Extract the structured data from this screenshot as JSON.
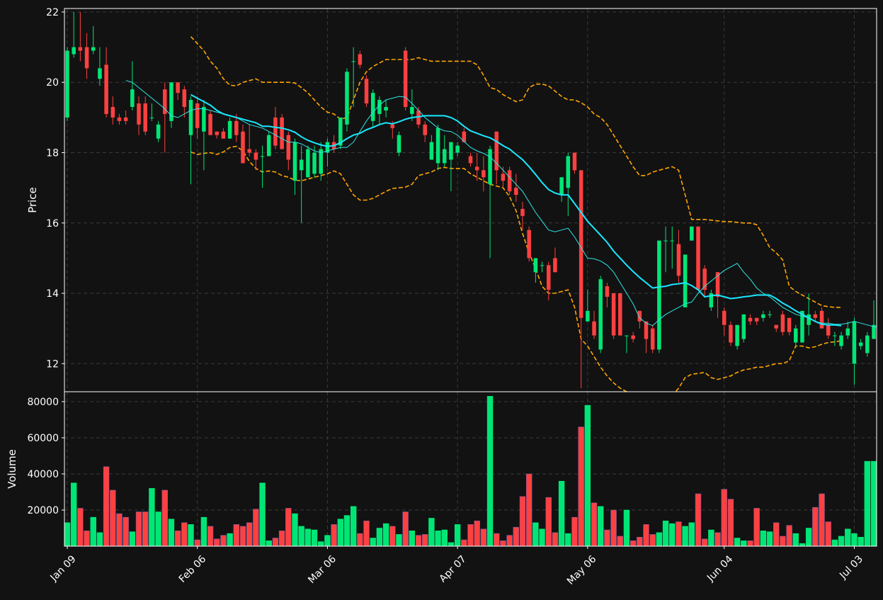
{
  "chart_data": {
    "type": "candlestick",
    "colors": {
      "background": "#121212",
      "up": "#00e676",
      "down": "#ff4040",
      "sma_fast": "#2ee6e6",
      "sma_slow": "#18e8ff",
      "bollinger": "#ffa500",
      "grid": "#3a3a3a",
      "frame": "#ffffff"
    },
    "price_panel": {
      "ylabel": "Price",
      "ylim": [
        11.2,
        22.1
      ],
      "yticks": [
        12,
        14,
        16,
        18,
        20,
        22
      ]
    },
    "volume_panel": {
      "ylabel": "Volume",
      "ylim": [
        0,
        85500
      ],
      "yticks": [
        20000,
        40000,
        60000,
        80000
      ]
    },
    "xticks": [
      {
        "index": 0,
        "label": "Jan 09"
      },
      {
        "index": 20,
        "label": "Feb 06"
      },
      {
        "index": 40,
        "label": "Mar 06"
      },
      {
        "index": 60,
        "label": "Apr 07"
      },
      {
        "index": 80,
        "label": "May 06"
      },
      {
        "index": 101,
        "label": "Jun 04"
      },
      {
        "index": 121,
        "label": "Jul 03"
      }
    ],
    "ohlcv": [
      [
        19.0,
        21.0,
        18.9,
        20.9,
        13000
      ],
      [
        20.8,
        22.0,
        20.7,
        21.0,
        35000
      ],
      [
        21.0,
        22.0,
        20.6,
        20.9,
        21000
      ],
      [
        21.0,
        21.4,
        20.1,
        20.4,
        8500
      ],
      [
        20.9,
        21.6,
        20.8,
        21.0,
        16000
      ],
      [
        20.1,
        21.0,
        19.9,
        20.4,
        7500
      ],
      [
        20.5,
        21.0,
        19.0,
        19.1,
        44000
      ],
      [
        19.3,
        19.6,
        18.8,
        19.0,
        31000
      ],
      [
        19.0,
        19.1,
        18.8,
        18.9,
        18000
      ],
      [
        19.0,
        19.2,
        18.8,
        18.9,
        16000
      ],
      [
        19.3,
        20.6,
        19.2,
        19.8,
        8000
      ],
      [
        19.4,
        19.6,
        18.5,
        18.8,
        19000
      ],
      [
        19.4,
        19.6,
        18.5,
        18.6,
        19000
      ],
      [
        19.0,
        19.4,
        18.9,
        19.0,
        32000
      ],
      [
        18.4,
        18.9,
        18.3,
        18.8,
        19000
      ],
      [
        19.8,
        20.0,
        18.0,
        19.1,
        31000
      ],
      [
        18.9,
        20.0,
        18.7,
        20.0,
        15000
      ],
      [
        20.0,
        20.0,
        19.5,
        19.7,
        8500
      ],
      [
        19.8,
        19.9,
        19.0,
        19.3,
        13000
      ],
      [
        18.5,
        19.6,
        17.1,
        19.5,
        12000
      ],
      [
        19.4,
        19.6,
        18.4,
        18.7,
        3500
      ],
      [
        18.6,
        19.5,
        17.5,
        19.3,
        16000
      ],
      [
        19.1,
        19.2,
        18.5,
        18.5,
        11000
      ],
      [
        18.6,
        18.6,
        18.4,
        18.5,
        4000
      ],
      [
        18.6,
        18.7,
        18.4,
        18.4,
        6000
      ],
      [
        18.4,
        19.0,
        18.4,
        18.9,
        7000
      ],
      [
        18.9,
        19.1,
        18.3,
        18.5,
        12000
      ],
      [
        18.6,
        18.8,
        17.7,
        17.7,
        11000
      ],
      [
        18.1,
        18.8,
        17.9,
        18.0,
        13000
      ],
      [
        18.0,
        18.1,
        17.5,
        17.8,
        20500
      ],
      [
        17.9,
        18.2,
        17.0,
        17.9,
        35000
      ],
      [
        17.9,
        18.6,
        17.9,
        18.5,
        3000
      ],
      [
        19.0,
        19.3,
        18.1,
        18.2,
        4500
      ],
      [
        19.0,
        19.1,
        18.2,
        18.1,
        8500
      ],
      [
        18.5,
        18.6,
        17.5,
        17.8,
        21000
      ],
      [
        17.2,
        18.4,
        16.8,
        18.3,
        18000
      ],
      [
        17.5,
        18.2,
        16.0,
        17.8,
        11000
      ],
      [
        17.3,
        18.2,
        17.3,
        18.1,
        9500
      ],
      [
        17.4,
        18.2,
        17.3,
        18.0,
        9000
      ],
      [
        17.4,
        18.3,
        17.2,
        18.1,
        2500
      ],
      [
        18.0,
        18.4,
        17.6,
        18.3,
        6000
      ],
      [
        18.3,
        18.5,
        18.0,
        18.1,
        12000
      ],
      [
        18.2,
        19.0,
        18.1,
        19.0,
        15000
      ],
      [
        18.8,
        20.4,
        18.6,
        20.3,
        17000
      ],
      [
        20.6,
        21.0,
        19.3,
        20.6,
        22000
      ],
      [
        20.8,
        20.9,
        20.4,
        20.5,
        7000
      ],
      [
        20.1,
        20.2,
        19.3,
        19.4,
        14000
      ],
      [
        18.9,
        19.8,
        18.7,
        19.7,
        4500
      ],
      [
        19.1,
        19.6,
        18.8,
        19.5,
        10000
      ],
      [
        19.2,
        19.5,
        19.0,
        19.3,
        12500
      ],
      [
        18.8,
        18.9,
        18.4,
        18.7,
        11000
      ],
      [
        18.0,
        18.6,
        17.9,
        18.5,
        6500
      ],
      [
        20.9,
        21.0,
        19.2,
        19.3,
        19000
      ],
      [
        19.1,
        19.8,
        18.9,
        19.3,
        8500
      ],
      [
        19.2,
        19.3,
        18.7,
        18.8,
        6000
      ],
      [
        18.8,
        18.9,
        18.3,
        18.5,
        6500
      ],
      [
        17.8,
        18.5,
        17.8,
        18.3,
        15500
      ],
      [
        17.7,
        18.8,
        17.5,
        18.7,
        8500
      ],
      [
        17.7,
        18.5,
        17.6,
        18.1,
        9000
      ],
      [
        17.8,
        18.3,
        16.9,
        18.3,
        2000
      ],
      [
        18.0,
        18.3,
        17.9,
        18.2,
        12000
      ],
      [
        18.6,
        18.7,
        18.3,
        18.3,
        3500
      ],
      [
        17.9,
        18.0,
        17.6,
        17.7,
        12000
      ],
      [
        17.6,
        18.0,
        17.2,
        17.5,
        14000
      ],
      [
        17.5,
        17.9,
        16.9,
        17.3,
        9500
      ],
      [
        17.1,
        18.2,
        15.0,
        18.1,
        83000
      ],
      [
        18.6,
        18.6,
        17.1,
        17.5,
        7000
      ],
      [
        17.4,
        17.6,
        17.0,
        17.2,
        3000
      ],
      [
        17.5,
        17.6,
        16.8,
        16.9,
        6000
      ],
      [
        17.0,
        17.4,
        16.6,
        16.8,
        10500
      ],
      [
        16.4,
        16.6,
        15.8,
        16.2,
        27500
      ],
      [
        15.8,
        15.9,
        14.9,
        15.0,
        40000
      ],
      [
        14.6,
        14.9,
        14.3,
        15.0,
        13000
      ],
      [
        14.8,
        14.9,
        14.6,
        14.8,
        9500
      ],
      [
        14.8,
        14.9,
        13.8,
        14.1,
        27000
      ],
      [
        15.0,
        15.3,
        14.6,
        14.6,
        7500
      ],
      [
        16.8,
        17.3,
        16.6,
        17.3,
        36000
      ],
      [
        17.0,
        18.0,
        16.2,
        17.9,
        7000
      ],
      [
        18.0,
        18.0,
        17.4,
        17.5,
        16000
      ],
      [
        17.5,
        17.5,
        11.3,
        13.3,
        66000
      ],
      [
        13.2,
        14.1,
        13.3,
        13.5,
        78000
      ],
      [
        13.2,
        13.5,
        12.7,
        12.8,
        24000
      ],
      [
        12.4,
        14.5,
        12.3,
        14.4,
        22000
      ],
      [
        14.2,
        14.3,
        13.6,
        13.9,
        9000
      ],
      [
        14.0,
        14.0,
        12.7,
        12.8,
        20000
      ],
      [
        14.0,
        14.0,
        12.8,
        12.8,
        5500
      ],
      [
        12.8,
        12.8,
        12.3,
        12.8,
        20000
      ],
      [
        12.8,
        12.9,
        12.6,
        12.7,
        3000
      ],
      [
        13.5,
        13.5,
        13.0,
        13.2,
        5000
      ],
      [
        13.2,
        13.2,
        12.3,
        12.7,
        12000
      ],
      [
        13.0,
        13.1,
        12.3,
        12.4,
        6500
      ],
      [
        12.4,
        15.5,
        12.3,
        15.5,
        7500
      ],
      [
        15.5,
        15.9,
        14.6,
        15.5,
        14000
      ],
      [
        15.5,
        15.9,
        14.7,
        15.5,
        12500
      ],
      [
        15.4,
        15.8,
        14.3,
        14.5,
        13500
      ],
      [
        13.6,
        15.1,
        13.6,
        15.1,
        11000
      ],
      [
        15.5,
        15.9,
        15.5,
        15.9,
        13000
      ],
      [
        15.9,
        15.9,
        14.1,
        14.1,
        29000
      ],
      [
        14.7,
        14.8,
        13.9,
        14.1,
        4000
      ],
      [
        13.6,
        14.1,
        13.5,
        14.0,
        9000
      ],
      [
        14.6,
        14.6,
        13.3,
        13.9,
        7500
      ],
      [
        13.5,
        13.6,
        12.8,
        13.1,
        31500
      ],
      [
        13.1,
        13.2,
        12.5,
        12.6,
        26000
      ],
      [
        12.5,
        13.1,
        12.4,
        13.1,
        4500
      ],
      [
        12.7,
        13.4,
        12.6,
        13.4,
        3000
      ],
      [
        13.3,
        13.4,
        13.1,
        13.2,
        3000
      ],
      [
        13.3,
        13.3,
        13.1,
        13.2,
        21000
      ],
      [
        13.3,
        13.5,
        13.2,
        13.4,
        8500
      ],
      [
        13.4,
        13.5,
        13.3,
        13.4,
        8000
      ],
      [
        13.1,
        13.1,
        12.9,
        13.0,
        13000
      ],
      [
        13.4,
        13.5,
        12.8,
        12.9,
        5500
      ],
      [
        13.3,
        13.3,
        12.8,
        12.9,
        11500
      ],
      [
        12.6,
        13.1,
        12.5,
        13.0,
        7000
      ],
      [
        12.6,
        13.4,
        12.6,
        13.5,
        1500
      ],
      [
        13.1,
        14.0,
        12.8,
        13.4,
        10000
      ],
      [
        13.4,
        13.5,
        13.2,
        13.3,
        21500
      ],
      [
        13.5,
        13.6,
        13.0,
        13.0,
        29000
      ],
      [
        13.1,
        13.3,
        12.7,
        12.8,
        13500
      ],
      [
        12.8,
        12.9,
        12.5,
        12.8,
        3500
      ],
      [
        12.5,
        12.9,
        12.4,
        12.8,
        5500
      ],
      [
        12.8,
        13.2,
        12.7,
        13.0,
        9500
      ],
      [
        12.0,
        13.3,
        11.4,
        13.2,
        7000
      ],
      [
        12.5,
        12.7,
        12.4,
        12.6,
        5000
      ],
      [
        12.3,
        12.9,
        12.2,
        12.8,
        47000
      ],
      [
        12.7,
        13.8,
        12.7,
        13.1,
        47000
      ]
    ],
    "overlays": {
      "sma_fast": {
        "start_index": 9,
        "values": [
          20.05,
          20.0,
          19.85,
          19.7,
          19.55,
          19.4,
          19.25,
          19.05,
          19.0,
          19.1,
          19.2,
          19.25,
          19.25,
          19.2,
          19.15,
          19.1,
          19.05,
          19.0,
          18.9,
          18.8,
          18.75,
          18.7,
          18.6,
          18.5,
          18.4,
          18.3,
          18.3,
          18.25,
          18.15,
          18.05,
          18.0,
          18.05,
          18.1,
          18.15,
          18.15,
          18.3,
          18.6,
          18.9,
          19.15,
          19.35,
          19.5,
          19.55,
          19.6,
          19.58,
          19.4,
          19.2,
          19.0,
          18.85,
          18.7,
          18.62,
          18.6,
          18.5,
          18.32,
          18.15,
          18.05,
          17.98,
          17.88,
          17.7,
          17.5,
          17.3,
          17.1,
          16.9,
          16.6,
          16.3,
          16.05,
          15.8,
          15.75,
          15.8,
          15.85,
          15.6,
          15.3,
          15.0,
          14.98,
          14.92,
          14.8,
          14.6,
          14.3,
          14.0,
          13.7,
          13.3,
          13.15,
          13.08,
          13.25,
          13.4,
          13.5,
          13.6,
          13.7,
          13.75,
          14.0,
          14.2,
          14.35,
          14.5,
          14.65,
          14.75,
          14.85,
          14.6,
          14.4,
          14.15,
          14.0,
          13.9,
          13.75,
          13.6,
          13.5,
          13.4,
          13.35,
          13.3,
          13.2,
          13.15,
          13.15,
          13.12,
          13.12,
          13.15,
          13.2,
          13.15,
          13.1,
          13.05,
          13.05,
          13.05,
          13.08,
          13.1
        ]
      },
      "sma_slow": {
        "start_index": 19,
        "values": [
          19.65,
          19.55,
          19.45,
          19.35,
          19.2,
          19.1,
          19.05,
          19.0,
          18.95,
          18.9,
          18.85,
          18.75,
          18.75,
          18.72,
          18.7,
          18.65,
          18.58,
          18.45,
          18.35,
          18.28,
          18.22,
          18.18,
          18.2,
          18.28,
          18.4,
          18.5,
          18.55,
          18.65,
          18.72,
          18.8,
          18.85,
          18.82,
          18.88,
          18.95,
          19.0,
          19.02,
          19.05,
          19.05,
          19.05,
          19.05,
          19.0,
          18.9,
          18.75,
          18.62,
          18.55,
          18.48,
          18.42,
          18.32,
          18.2,
          18.1,
          17.95,
          17.8,
          17.6,
          17.38,
          17.15,
          16.95,
          16.85,
          16.8,
          16.8,
          16.55,
          16.3,
          16.05,
          15.85,
          15.65,
          15.45,
          15.2,
          15.0,
          14.8,
          14.62,
          14.45,
          14.3,
          14.15,
          14.18,
          14.2,
          14.25,
          14.27,
          14.3,
          14.22,
          14.1,
          13.9,
          13.93,
          13.95,
          13.9,
          13.85,
          13.87,
          13.9,
          13.92,
          13.95,
          13.95,
          13.95,
          13.85,
          13.72,
          13.62,
          13.5,
          13.4,
          13.3,
          13.2,
          13.12,
          13.1,
          13.1,
          13.08
        ]
      },
      "bb_upper": {
        "start_index": 19,
        "values": [
          21.3,
          21.1,
          20.9,
          20.6,
          20.4,
          20.1,
          19.92,
          19.9,
          20.0,
          20.05,
          20.1,
          20.0,
          20.0,
          20.0,
          20.0,
          20.0,
          19.98,
          19.85,
          19.7,
          19.5,
          19.3,
          19.15,
          19.1,
          18.95,
          19.0,
          19.5,
          20.0,
          20.3,
          20.45,
          20.55,
          20.65,
          20.65,
          20.65,
          20.65,
          20.65,
          20.7,
          20.65,
          20.6,
          20.6,
          20.6,
          20.6,
          20.6,
          20.6,
          20.6,
          20.5,
          20.2,
          19.85,
          19.8,
          19.65,
          19.55,
          19.45,
          19.5,
          19.85,
          19.95,
          19.95,
          19.9,
          19.75,
          19.6,
          19.5,
          19.5,
          19.42,
          19.3,
          19.1,
          19.0,
          18.8,
          18.5,
          18.2,
          17.9,
          17.6,
          17.35,
          17.35,
          17.45,
          17.5,
          17.55,
          17.6,
          17.5,
          16.8,
          16.1,
          16.1,
          16.1,
          16.08,
          16.06,
          16.04,
          16.04,
          16.02,
          16.0,
          16.0,
          15.95,
          15.65,
          15.3,
          15.15,
          14.95,
          14.2,
          14.05,
          13.95,
          13.85,
          13.75,
          13.65,
          13.62,
          13.6,
          13.6
        ]
      },
      "bb_lower": {
        "start_index": 19,
        "values": [
          18.02,
          17.95,
          17.98,
          18.0,
          17.95,
          18.02,
          18.15,
          18.18,
          18.05,
          17.75,
          17.55,
          17.45,
          17.48,
          17.45,
          17.35,
          17.3,
          17.22,
          17.2,
          17.25,
          17.3,
          17.35,
          17.4,
          17.48,
          17.4,
          17.1,
          16.8,
          16.65,
          16.65,
          16.7,
          16.8,
          16.9,
          16.98,
          17.0,
          17.02,
          17.1,
          17.35,
          17.4,
          17.45,
          17.55,
          17.58,
          17.55,
          17.55,
          17.55,
          17.4,
          17.3,
          17.2,
          17.1,
          17.05,
          17.0,
          16.75,
          16.35,
          15.7,
          15.15,
          14.7,
          14.2,
          14.0,
          14.0,
          14.05,
          14.1,
          13.6,
          12.7,
          12.5,
          12.2,
          11.9,
          11.65,
          11.45,
          11.3,
          11.2,
          11.15,
          11.1,
          11.05,
          11.0,
          10.95,
          11.0,
          11.1,
          11.3,
          11.6,
          11.7,
          11.72,
          11.75,
          11.6,
          11.55,
          11.6,
          11.65,
          11.75,
          11.82,
          11.85,
          11.9,
          11.9,
          11.95,
          12.0,
          12.0,
          12.08,
          12.5,
          12.5,
          12.45,
          12.48,
          12.55,
          12.6,
          12.62,
          12.65
        ]
      }
    }
  }
}
